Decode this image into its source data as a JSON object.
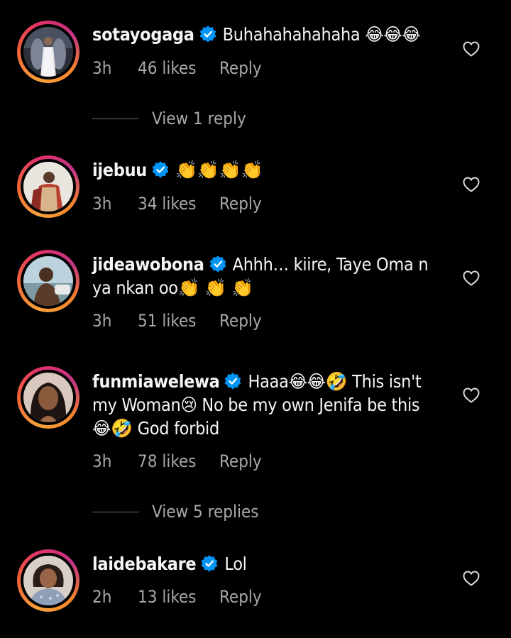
{
  "comments": [
    {
      "username": "sotayogaga",
      "text": "Buhahahahahaha 😂😂😂",
      "time": "3h",
      "likes": "46 likes",
      "reply": "Reply",
      "view_replies": "View 1 reply"
    },
    {
      "username": "ijebuu",
      "text": "👏👏👏👏",
      "time": "3h",
      "likes": "34 likes",
      "reply": "Reply"
    },
    {
      "username": "jideawobona",
      "text_line1": "Ahhh… kiire, Taye Oma n",
      "text_line2": "ya nkan oo👏 👏 👏",
      "time": "3h",
      "likes": "51 likes",
      "reply": "Reply"
    },
    {
      "username": "funmiawelewa",
      "text_line1": "Haaa😂😂🤣 This isn't",
      "text_line2": "my Woman😢 No be my own Jenifa be this",
      "text_line3": "😂🤣 God forbid",
      "time": "3h",
      "likes": "78 likes",
      "reply": "Reply",
      "view_replies": "View 5 replies"
    },
    {
      "username": "laidebakare",
      "text": "Lol",
      "time": "2h",
      "likes": "13 likes",
      "reply": "Reply"
    }
  ],
  "icons": {
    "verified": "verified-badge-icon",
    "like": "heart-outline-icon"
  },
  "colors": {
    "background": "#000000",
    "text": "#f5f5f5",
    "meta": "#a8a8a8",
    "verified": "#0095f6"
  }
}
